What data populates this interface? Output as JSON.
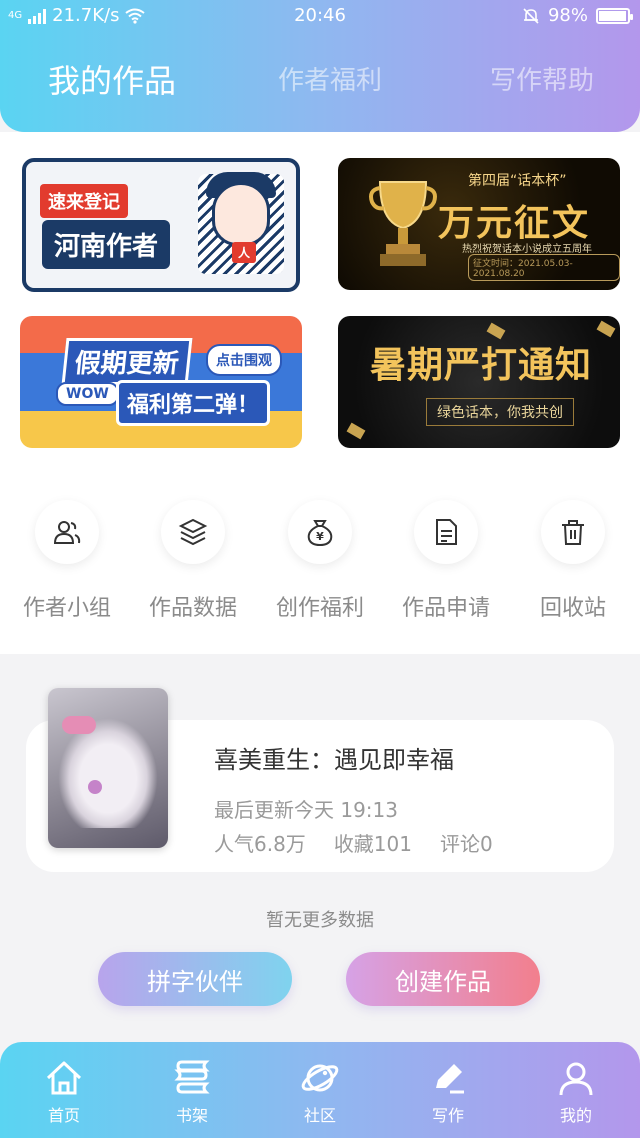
{
  "status": {
    "network": "4G",
    "speed": "21.7K/s",
    "time": "20:46",
    "battery": "98%",
    "battery_level": 0.98
  },
  "tabs": [
    {
      "label": "我的作品",
      "active": true
    },
    {
      "label": "作者福利",
      "active": false
    },
    {
      "label": "写作帮助",
      "active": false
    }
  ],
  "banners": {
    "b1": {
      "chip": "速来登记",
      "title": "河南作者",
      "badge": "人"
    },
    "b2": {
      "sub": "第四届“话本杯”",
      "title": "万元征文",
      "desc": "热烈祝贺话本小说成立五周年",
      "date": "征文时间：2021.05.03-2021.08.20"
    },
    "b3": {
      "title": "假期更新",
      "chip": "点击围观",
      "wow": "WOW",
      "sub": "福利第二弹！"
    },
    "b4": {
      "title": "暑期严打通知",
      "sub": "绿色话本，你我共创"
    }
  },
  "grid": [
    {
      "label": "作者小组",
      "icon": "users-icon"
    },
    {
      "label": "作品数据",
      "icon": "layers-icon"
    },
    {
      "label": "创作福利",
      "icon": "money-bag-icon"
    },
    {
      "label": "作品申请",
      "icon": "document-icon"
    },
    {
      "label": "回收站",
      "icon": "trash-icon"
    }
  ],
  "work": {
    "title": "喜美重生：遇见即幸福",
    "updated": "最后更新今天 19:13",
    "popularity": "人气6.8万",
    "favorites": "收藏101",
    "comments": "评论0"
  },
  "no_more": "暂无更多数据",
  "buttons": {
    "left": "拼字伙伴",
    "right": "创建作品"
  },
  "nav": [
    {
      "label": "首页",
      "icon": "home-icon"
    },
    {
      "label": "书架",
      "icon": "bookshelf-icon"
    },
    {
      "label": "社区",
      "icon": "planet-icon"
    },
    {
      "label": "写作",
      "icon": "pen-icon"
    },
    {
      "label": "我的",
      "icon": "user-icon"
    }
  ],
  "colors": {
    "gradient_start": "#5ad4f2",
    "gradient_end": "#b397ec",
    "button_left": "#7fd3ee",
    "button_right": "#f27f8d"
  }
}
